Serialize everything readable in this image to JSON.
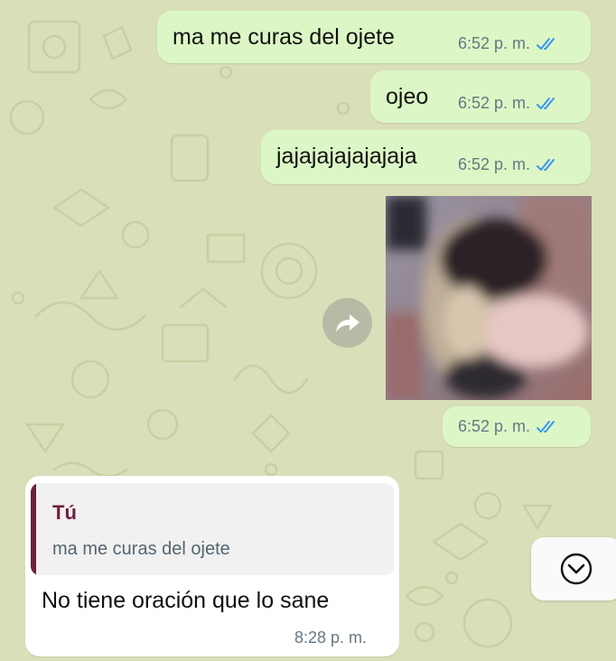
{
  "colors": {
    "wallpaper": "#d9dfb8",
    "outgoing_bubble": "#dcf7c5",
    "incoming_bubble": "#ffffff",
    "read_ticks": "#3b95f0",
    "quote_accent": "#6e1f40"
  },
  "messages": [
    {
      "direction": "outgoing",
      "text": "ma me curas del ojete",
      "time": "6:52 p. m.",
      "status": "read"
    },
    {
      "direction": "outgoing",
      "text": "ojeo",
      "time": "6:52 p. m.",
      "status": "read"
    },
    {
      "direction": "outgoing",
      "text": "jajajajajajajaja",
      "time": "6:52 p. m.",
      "status": "read"
    },
    {
      "direction": "outgoing",
      "type": "media",
      "time": "6:52 p. m.",
      "status": "read",
      "forward_icon": "forward-arrow-icon"
    },
    {
      "direction": "incoming",
      "quote": {
        "author": "Tú",
        "text": "ma me curas del ojete"
      },
      "text": "No tiene oración que lo sane",
      "time": "8:28 p. m."
    }
  ],
  "scroll_to_bottom_icon": "chevron-down-circle-icon"
}
